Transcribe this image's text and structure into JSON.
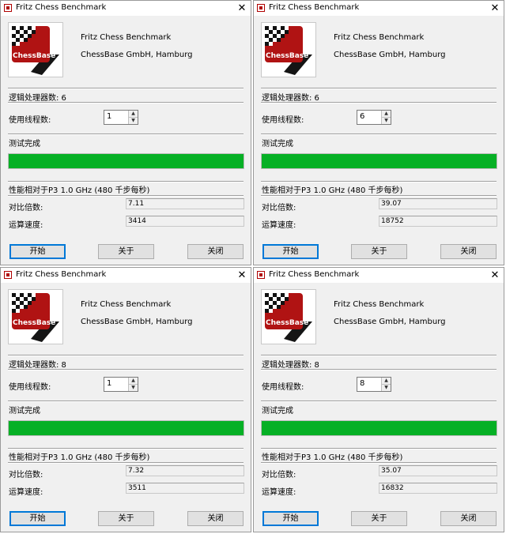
{
  "windows": [
    {
      "title": "Fritz Chess Benchmark",
      "close_glyph": "✕",
      "logo_text": "ChessBase",
      "product": "Fritz Chess Benchmark",
      "company": "ChessBase GmbH, Hamburg",
      "logical_processors": "逻辑处理器数: 6",
      "threads_label": "使用线程数:",
      "threads_value": "1",
      "status": "测试完成",
      "progress": 1.0,
      "perf_label": "性能相对于P3 1.0 GHz (480 千步每秒)",
      "ratio_label": "对比倍数:",
      "ratio_value": "7.11",
      "speed_label": "运算速度:",
      "speed_value": "3414",
      "buttons": {
        "start": "开始",
        "about": "关于",
        "close": "关闭"
      }
    },
    {
      "title": "Fritz Chess Benchmark",
      "close_glyph": "✕",
      "logo_text": "ChessBase",
      "product": "Fritz Chess Benchmark",
      "company": "ChessBase GmbH, Hamburg",
      "logical_processors": "逻辑处理器数: 6",
      "threads_label": "使用线程数:",
      "threads_value": "6",
      "status": "测试完成",
      "progress": 1.0,
      "perf_label": "性能相对于P3 1.0 GHz (480 千步每秒)",
      "ratio_label": "对比倍数:",
      "ratio_value": "39.07",
      "speed_label": "运算速度:",
      "speed_value": "18752",
      "buttons": {
        "start": "开始",
        "about": "关于",
        "close": "关闭"
      }
    },
    {
      "title": "Fritz Chess Benchmark",
      "close_glyph": "✕",
      "logo_text": "ChessBase",
      "product": "Fritz Chess Benchmark",
      "company": "ChessBase GmbH, Hamburg",
      "logical_processors": "逻辑处理器数: 8",
      "threads_label": "使用线程数:",
      "threads_value": "1",
      "status": "测试完成",
      "progress": 1.0,
      "perf_label": "性能相对于P3 1.0 GHz (480 千步每秒)",
      "ratio_label": "对比倍数:",
      "ratio_value": "7.32",
      "speed_label": "运算速度:",
      "speed_value": "3511",
      "buttons": {
        "start": "开始",
        "about": "关于",
        "close": "关闭"
      }
    },
    {
      "title": "Fritz Chess Benchmark",
      "close_glyph": "✕",
      "logo_text": "ChessBase",
      "product": "Fritz Chess Benchmark",
      "company": "ChessBase GmbH, Hamburg",
      "logical_processors": "逻辑处理器数: 8",
      "threads_label": "使用线程数:",
      "threads_value": "8",
      "status": "测试完成",
      "progress": 1.0,
      "perf_label": "性能相对于P3 1.0 GHz (480 千步每秒)",
      "ratio_label": "对比倍数:",
      "ratio_value": "35.07",
      "speed_label": "运算速度:",
      "speed_value": "16832",
      "buttons": {
        "start": "开始",
        "about": "关于",
        "close": "关闭"
      }
    }
  ],
  "colors": {
    "progress_fill": "#06b025",
    "logo_red": "#b01313",
    "focus_border": "#0078d7"
  }
}
